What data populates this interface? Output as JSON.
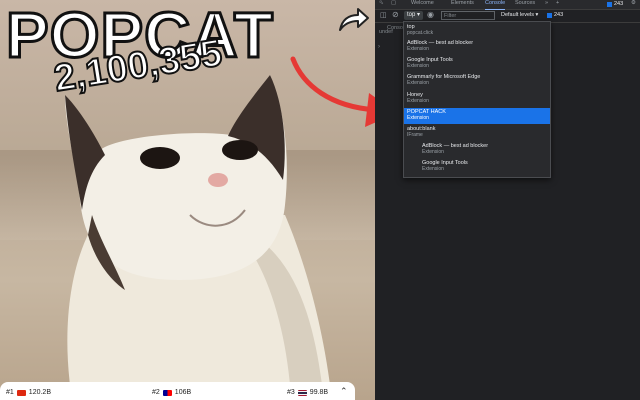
{
  "game": {
    "title": "POPCAT",
    "counter": "2,100,355",
    "leaderboard": [
      {
        "rank": "#1",
        "value": "120.2B"
      },
      {
        "rank": "#2",
        "value": "106B"
      },
      {
        "rank": "#3",
        "value": "99.8B"
      }
    ]
  },
  "devtools": {
    "tabs": [
      "Welcome",
      "Elements",
      "Console",
      "Sources"
    ],
    "context_value": "top",
    "filter_placeholder": "Filter",
    "levels_label": "Default levels",
    "issues_count": "243",
    "top_issues_count": "243",
    "console_label": "Console",
    "console_line": "undef",
    "context_options": [
      {
        "title": "top",
        "subtitle": "popcat.click",
        "indent": 0,
        "selected": false
      },
      {
        "title": "AdBlock — best ad blocker",
        "subtitle": "Extension",
        "indent": 1,
        "selected": false
      },
      {
        "title": "Google Input Tools",
        "subtitle": "Extension",
        "indent": 1,
        "selected": false
      },
      {
        "title": "Grammarly for Microsoft Edge",
        "subtitle": "Extension",
        "indent": 1,
        "selected": false
      },
      {
        "title": "Honey",
        "subtitle": "Extension",
        "indent": 1,
        "selected": false
      },
      {
        "title": "POPCAT HACK",
        "subtitle": "Extension",
        "indent": 1,
        "selected": true
      },
      {
        "title": "about:blank",
        "subtitle": "IFrame",
        "indent": 1,
        "selected": false
      },
      {
        "title": "AdBlock — best ad blocker",
        "subtitle": "Extension",
        "indent": 2,
        "selected": false
      },
      {
        "title": "Google Input Tools",
        "subtitle": "Extension",
        "indent": 2,
        "selected": false
      }
    ]
  },
  "colors": {
    "accent": "#1a73e8",
    "arrow": "#e53935"
  }
}
